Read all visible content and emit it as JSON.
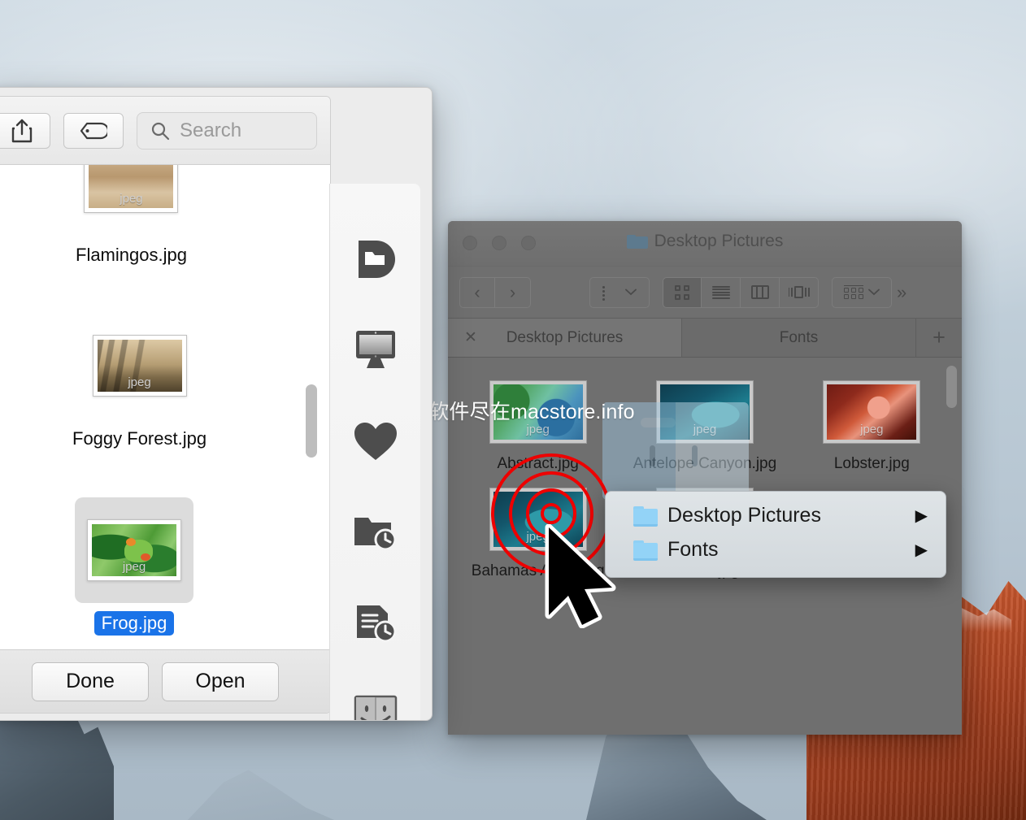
{
  "watermark": "精品Mac软件尽在macstore.info",
  "finder_window": {
    "title": "Desktop Pictures",
    "title_icon": "folder-icon",
    "traffic_lights": [
      "close-button",
      "minimize-button",
      "zoom-button"
    ],
    "toolbar": {
      "back_label": "‹",
      "forward_label": "›",
      "arrange_icon": "arrange-list-icon",
      "view_icon_label": "icon-view",
      "view_list_label": "list-view",
      "view_column_label": "column-view",
      "view_coverflow_label": "coverflow-view",
      "action_icon": "action-grid-icon",
      "overflow_label": "»"
    },
    "tabs": [
      {
        "label": "Desktop Pictures",
        "active": true,
        "closable": true
      },
      {
        "label": "Fonts",
        "active": false,
        "closable": false
      }
    ],
    "new_tab_label": "+",
    "files": [
      {
        "name": "Abstract.jpg",
        "art": "art-abstract",
        "badge": "jpeg"
      },
      {
        "name": "Antelope Canyon.jpg",
        "art": "art-bahamas",
        "badge": "jpeg"
      },
      {
        "name": "Lobster.jpg",
        "art": "art-lobster",
        "badge": "jpeg"
      },
      {
        "name": "Bahamas Aerial.jpg",
        "art": "art-bahamas",
        "badge": "jpeg"
      },
      {
        "name": "Beach.jpg",
        "art": "art-beach",
        "badge": "jpeg"
      }
    ]
  },
  "context_menu": {
    "items": [
      {
        "label": "Desktop Pictures",
        "icon": "folder-icon",
        "submenu_arrow": "▶"
      },
      {
        "label": "Fonts",
        "icon": "folder-icon",
        "submenu_arrow": "▶"
      }
    ]
  },
  "open_panel": {
    "toolbar": {
      "share_icon": "share-icon",
      "tag_icon": "tag-icon",
      "search_icon": "search-icon",
      "search_value": "",
      "search_placeholder": "Search"
    },
    "files": [
      {
        "name": "Flamingos.jpg",
        "art": "art-flamingos",
        "badge": "jpeg",
        "selected": false
      },
      {
        "name": "Foggy Forest.jpg",
        "art": "art-foggy",
        "badge": "jpeg",
        "selected": false
      },
      {
        "name": "Frog.jpg",
        "art": "art-frog",
        "badge": "jpeg",
        "selected": true
      }
    ],
    "footer": {
      "done_label": "Done",
      "open_label": "Open"
    }
  },
  "icon_strip": {
    "items": [
      {
        "name": "dropbox-icon"
      },
      {
        "name": "desktop-display-icon"
      },
      {
        "name": "heart-favorites-icon"
      },
      {
        "name": "recent-folders-icon"
      },
      {
        "name": "recent-documents-icon"
      },
      {
        "name": "finder-face-icon"
      }
    ]
  },
  "colors": {
    "selection_blue": "#1a73e8",
    "click_ring_red": "#ee0000",
    "finder_chrome_gray": "#6f6f6f",
    "context_menu_bg": "#dfe4e7",
    "folder_blue": "#93d3f7"
  }
}
